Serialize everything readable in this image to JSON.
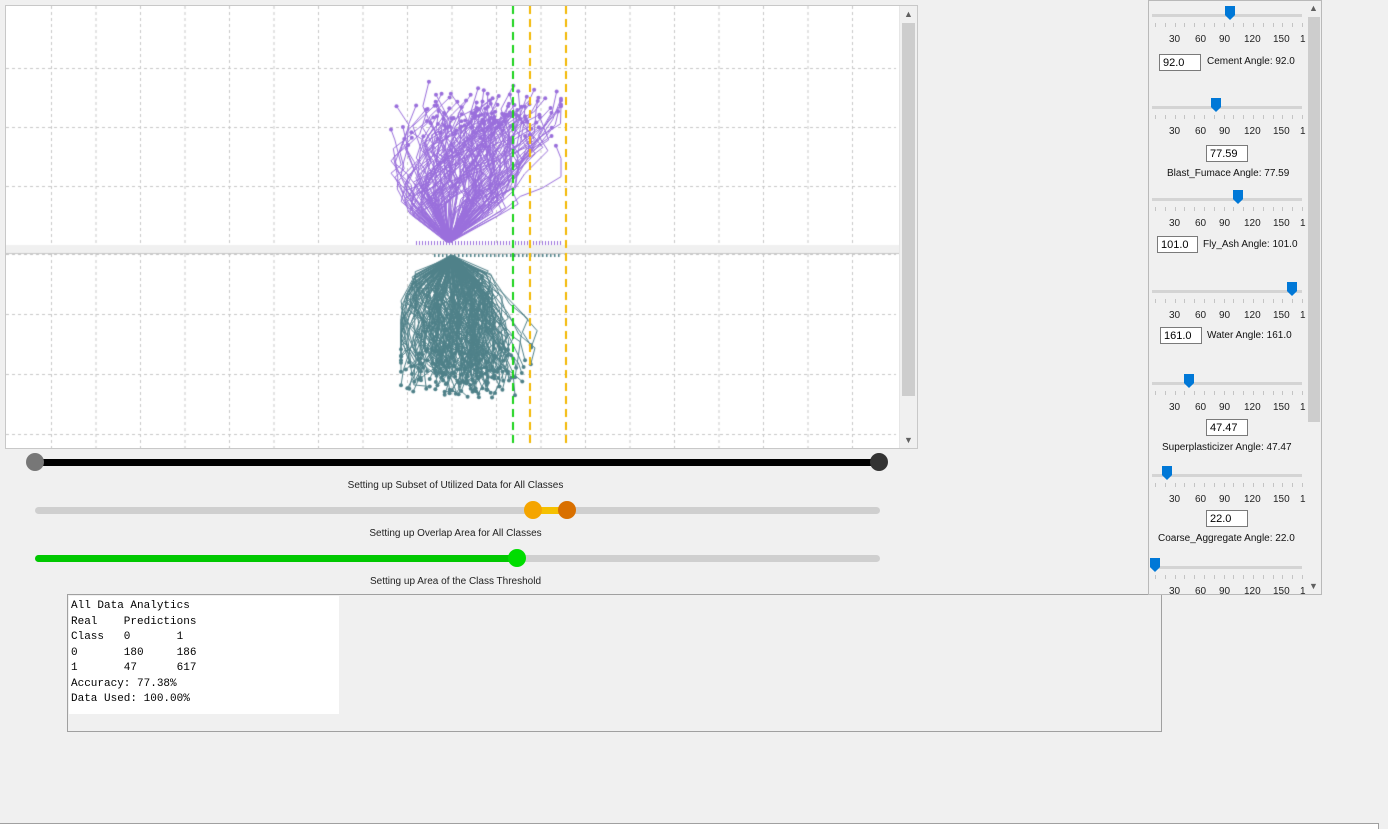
{
  "plot": {
    "colors": {
      "class0": "#9a6fdc",
      "class1": "#4f8189",
      "green_line": "#19d219",
      "orange_line": "#f2b800",
      "grid": "#c8c8c8"
    }
  },
  "scrollbar": {
    "up_icon": "▲",
    "down_icon": "▼"
  },
  "sliders": {
    "subset": {
      "label": "Setting up Subset of Utilized Data for All Classes",
      "low": 0.0,
      "high": 1.0,
      "color": "#000000"
    },
    "overlap": {
      "label": "Setting up Overlap Area for All Classes",
      "low": 0.59,
      "high": 0.63,
      "color_low": "#f5a500",
      "color_high": "#d97000"
    },
    "threshold": {
      "label": "Setting up Area of the Class Threshold",
      "value": 0.57,
      "color": "#00c800"
    }
  },
  "analytics": {
    "title": "All Data Analytics",
    "header1": "Real    Predictions",
    "header2": "Class   0       1",
    "row0": "0       180     186",
    "row1": "1       47      617",
    "accuracy": "Accuracy: 77.38%",
    "data_used": "Data Used: 100.00%"
  },
  "angles": {
    "scale": [
      "30",
      "60",
      "90",
      "120",
      "150",
      "1"
    ],
    "items": [
      {
        "value": "92.0",
        "label": "Cement Angle: 92.0"
      },
      {
        "value": "77.59",
        "label": "Blast_Fumace Angle: 77.59"
      },
      {
        "value": "101.0",
        "label": "Fly_Ash Angle: 101.0"
      },
      {
        "value": "161.0",
        "label": "Water Angle: 161.0"
      },
      {
        "value": "47.47",
        "label": "Superplasticizer Angle: 47.47"
      },
      {
        "value": "22.0",
        "label": "Coarse_Aggregate Angle: 22.0"
      },
      {
        "value": "",
        "label": ""
      }
    ]
  }
}
